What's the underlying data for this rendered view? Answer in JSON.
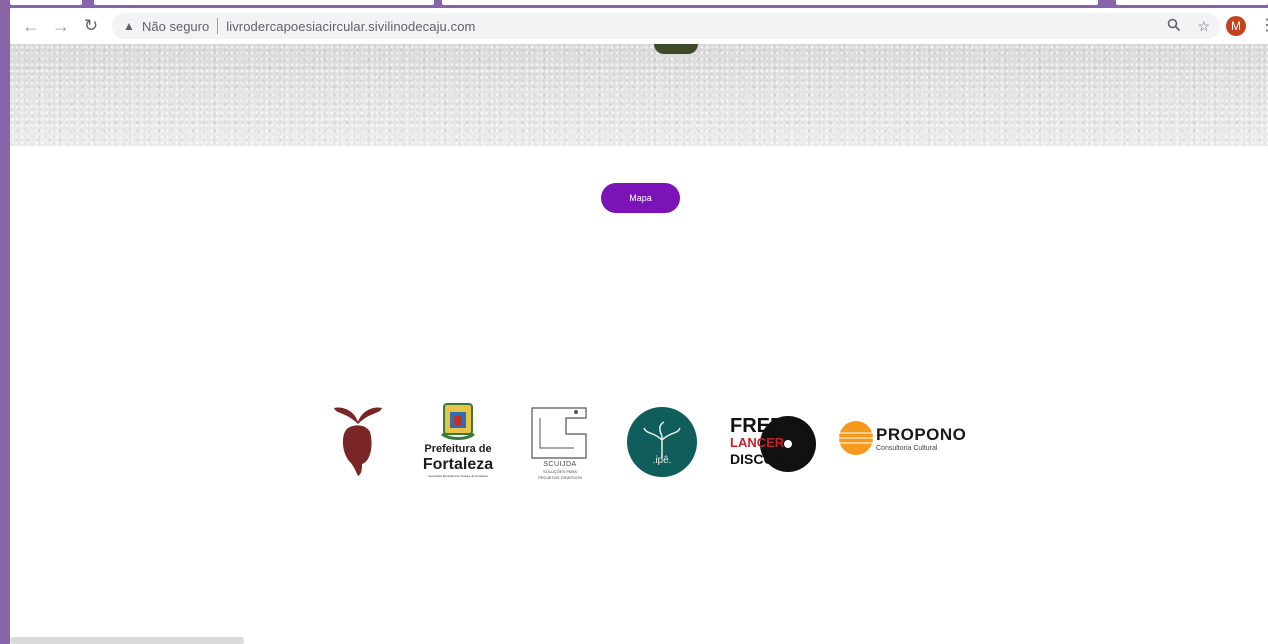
{
  "browser": {
    "security_label": "Não seguro",
    "url": "livrodercapoesiacircular.sivilinodecaju.com",
    "profile_initial": "M",
    "icons": {
      "back": "arrow-left-icon",
      "forward": "arrow-right-icon",
      "reload": "reload-icon",
      "warning": "warning-triangle-icon",
      "search": "magnifier-icon",
      "bookmark": "star-icon",
      "menu": "kebab-menu-icon"
    },
    "colors": {
      "frame": "#8765a8",
      "avatar": "#c5431c"
    }
  },
  "page": {
    "map_button_label": "Mapa",
    "map_button_color": "#7b13b7",
    "sponsors": [
      {
        "name": "cashew-logo",
        "text": ""
      },
      {
        "name": "prefeitura-logo",
        "line1": "Prefeitura de",
        "line2": "Fortaleza",
        "sub": "Secretaria Municipal de Cultura de Fortaleza"
      },
      {
        "name": "scuilda-logo",
        "line1": "SCUIJDA",
        "sub1": "SOLUÇÕES PARA",
        "sub2": "PROJETOS CRIATIVOS"
      },
      {
        "name": "ipe-logo",
        "text": ".ipê."
      },
      {
        "name": "freelancer-discos-logo",
        "line1": "FREE",
        "line2": "LANCER",
        "line3": "DISCOS"
      },
      {
        "name": "propono-logo",
        "line1": "PROPONO",
        "line2": "Consultoria Cultural"
      }
    ]
  }
}
